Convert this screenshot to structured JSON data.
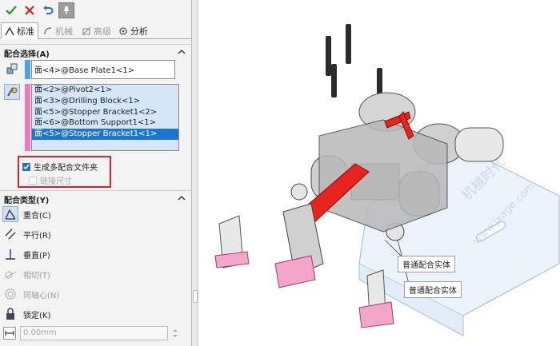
{
  "toolbar": {
    "ok_icon": "check-icon",
    "cancel_icon": "x-icon",
    "undo_icon": "undo-icon",
    "pin_icon": "pushpin-icon"
  },
  "tabs": [
    {
      "label": "标准",
      "icon": "standard-mate-icon",
      "active": true
    },
    {
      "label": "机械",
      "icon": "mechanical-mate-icon",
      "active": false
    },
    {
      "label": "高级",
      "icon": "advanced-mate-icon",
      "active": false
    },
    {
      "label": "分析",
      "icon": "analysis-icon",
      "active": false
    }
  ],
  "mate_selections": {
    "title": "配合选择(A)",
    "field1": "面<4>@Base Plate1<1>",
    "list2": [
      "面<2>@Pivot2<1>",
      "面<3>@Drilling Block<1>",
      "面<5>@Stopper Bracket1<2>",
      "面<6>@Bottom Support1<1>",
      "面<5>@Stopper Bracket1<1>"
    ],
    "selected_index": 4,
    "field1_color": "#4aa3e8",
    "list2_color": "#f07ab8"
  },
  "options": {
    "multi_mate_folder": "生成多配合文件夹",
    "link_dimensions": "链接尺寸"
  },
  "mate_types": {
    "title": "配合类型(Y)",
    "items": [
      {
        "label": "重合(C)",
        "icon": "coincident-icon"
      },
      {
        "label": "平行(R)",
        "icon": "parallel-icon"
      },
      {
        "label": "垂直(P)",
        "icon": "perpendicular-icon"
      },
      {
        "label": "相切(T)",
        "icon": "tangent-icon"
      },
      {
        "label": "同轴心(N)",
        "icon": "concentric-icon"
      },
      {
        "label": "锁定(K)",
        "icon": "lock-icon"
      }
    ],
    "distance_value": "0.00mm"
  },
  "viewport": {
    "callout1": "普通配合实体",
    "callout2": "普通配合实体",
    "watermark1": "机械时代",
    "watermark2": "www.jxage.com"
  },
  "colors": {
    "accent": "#1c75cf",
    "highlight_red": "#e0202e",
    "selected_part": "#e8231d",
    "pink_part": "#f4a6c8"
  }
}
